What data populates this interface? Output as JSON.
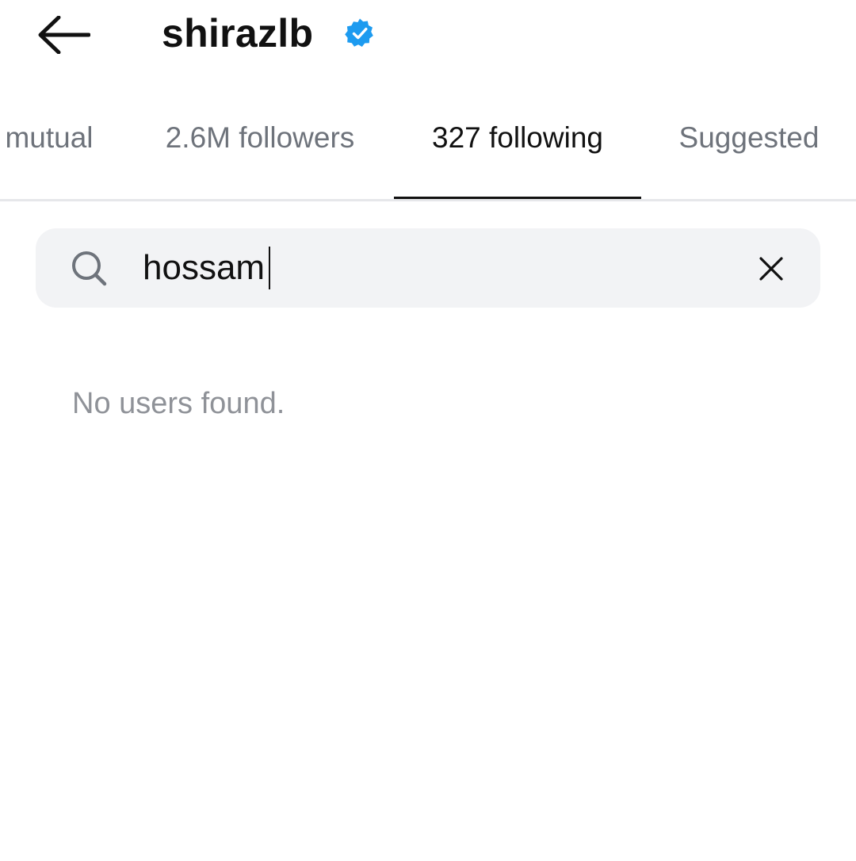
{
  "header": {
    "back_icon": "arrow-left-icon",
    "username": "shirazlb",
    "verified_icon": "verified-badge-icon",
    "verified_color": "#1d9bf0"
  },
  "tabs": [
    {
      "label": "mutual",
      "active": false
    },
    {
      "label": "2.6M followers",
      "active": false
    },
    {
      "label": "327 following",
      "active": true
    },
    {
      "label": "Suggested",
      "active": false
    }
  ],
  "search": {
    "icon": "search-icon",
    "value": "hossam",
    "clear_icon": "close-icon"
  },
  "results": {
    "empty_message": "No users found."
  }
}
